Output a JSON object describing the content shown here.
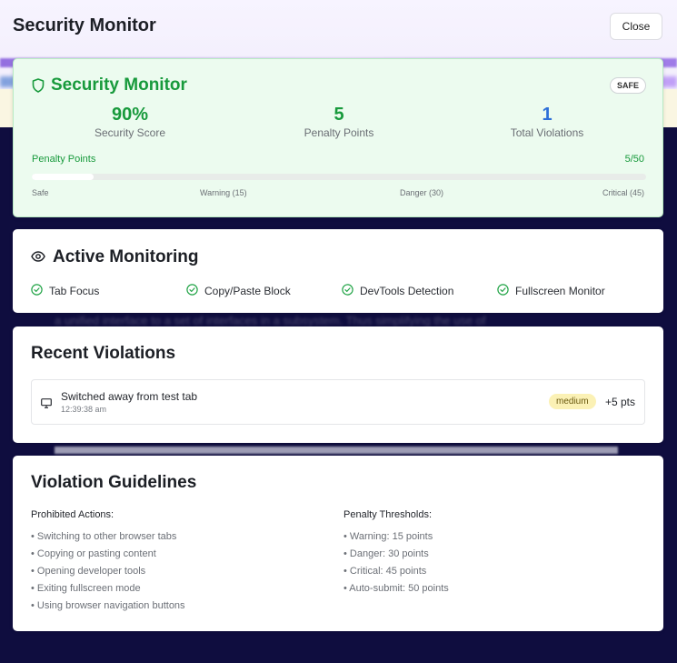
{
  "header": {
    "title": "Security Monitor",
    "close_label": "Close"
  },
  "backdrop": {
    "text": "a unified interface to a set of interfaces in a subsystem. Thus simplifying the use of"
  },
  "status": {
    "title": "Security Monitor",
    "badge": "SAFE",
    "metrics": [
      {
        "value": "90%",
        "label": "Security Score"
      },
      {
        "value": "5",
        "label": "Penalty Points"
      },
      {
        "value": "1",
        "label": "Total Violations"
      }
    ],
    "penalty_label": "Penalty Points",
    "penalty_value": "5/50",
    "penalty_fraction": 0.1,
    "scale": [
      "Safe",
      "Warning (15)",
      "Danger (30)",
      "Critical (45)"
    ],
    "accent": "#189a3c"
  },
  "monitoring": {
    "title": "Active Monitoring",
    "items": [
      "Tab Focus",
      "Copy/Paste Block",
      "DevTools Detection",
      "Fullscreen Monitor"
    ]
  },
  "recent": {
    "title": "Recent Violations",
    "items": [
      {
        "icon": "monitor-icon",
        "text": "Switched away from test tab",
        "time": "12:39:38 am",
        "severity": "medium",
        "points": "+5 pts"
      }
    ]
  },
  "guidelines": {
    "title": "Violation Guidelines",
    "prohibited": {
      "heading": "Prohibited Actions:",
      "items": [
        "• Switching to other browser tabs",
        "• Copying or pasting content",
        "• Opening developer tools",
        "• Exiting fullscreen mode",
        "• Using browser navigation buttons"
      ]
    },
    "thresholds": {
      "heading": "Penalty Thresholds:",
      "items": [
        "• Warning: 15 points",
        "• Danger: 30 points",
        "• Critical: 45 points",
        "• Auto-submit: 50 points"
      ]
    }
  }
}
